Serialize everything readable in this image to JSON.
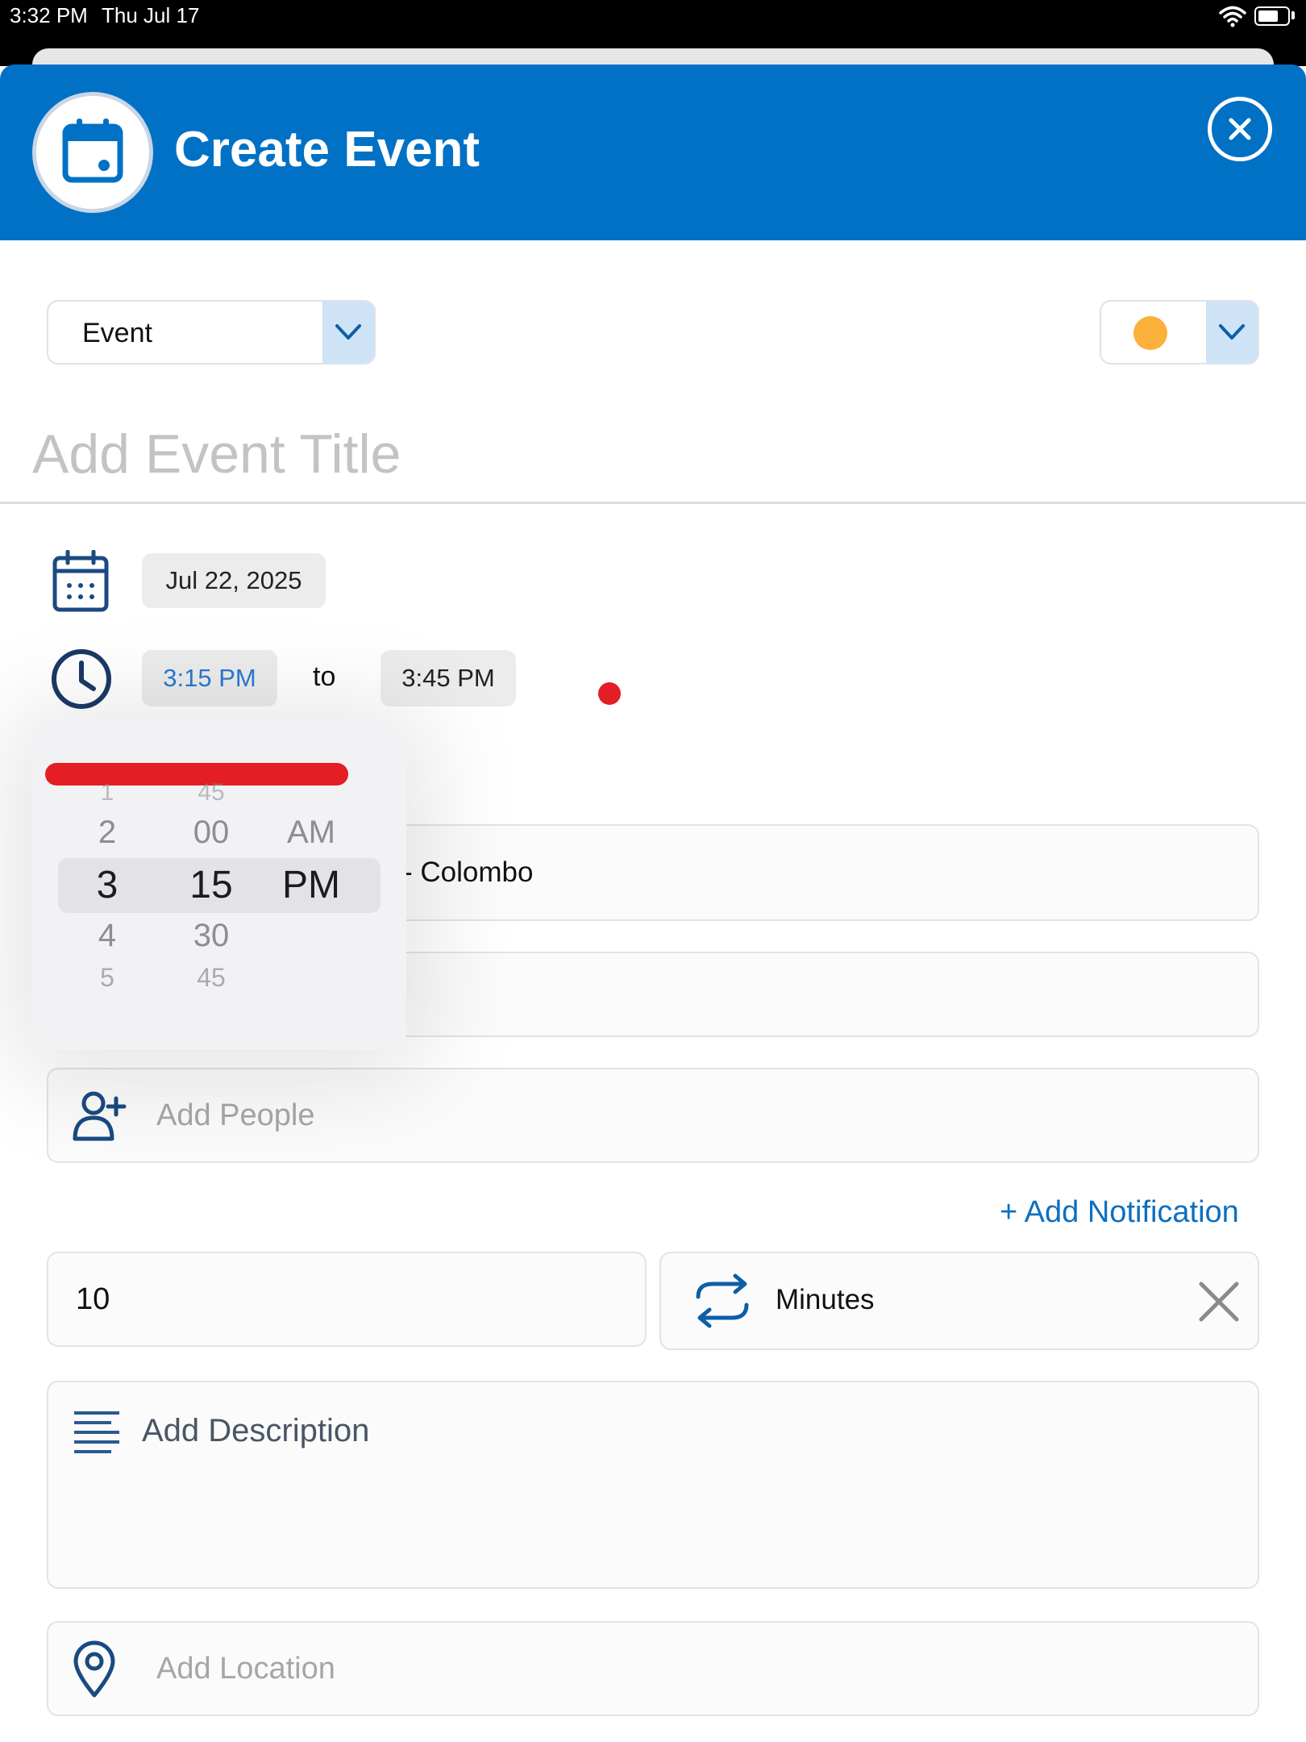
{
  "status_bar": {
    "time": "3:32 PM",
    "date": "Thu Jul 17"
  },
  "header": {
    "title": "Create Event",
    "close_icon": "close-circle-icon",
    "badge_icon": "calendar-icon"
  },
  "type_select": {
    "value": "Event",
    "icon": "chevron-down-icon"
  },
  "color_select": {
    "value": "#fbb03b",
    "icon": "chevron-down-icon"
  },
  "title_input": {
    "placeholder": "Add Event Title",
    "value": ""
  },
  "date_row": {
    "icon": "calendar-icon",
    "date": "Jul 22, 2025"
  },
  "time_row": {
    "icon": "clock-icon",
    "start": "3:15 PM",
    "separator": "to",
    "end": "3:45 PM"
  },
  "time_picker": {
    "hours": [
      "1",
      "2",
      "3",
      "4",
      "5"
    ],
    "minutes": [
      "45",
      "00",
      "15",
      "30",
      "45"
    ],
    "periods": [
      "AM",
      "PM"
    ],
    "selected": {
      "hour": "3",
      "minute": "15",
      "period": "PM"
    }
  },
  "timezone_field": {
    "visible_text": "- Colombo"
  },
  "people_field": {
    "icon": "add-person-icon",
    "placeholder": "Add People"
  },
  "notification": {
    "add_label": "+ Add Notification",
    "value": "10",
    "unit": "Minutes",
    "unit_icon": "repeat-icon",
    "remove_icon": "close-icon"
  },
  "description_field": {
    "icon": "align-left-icon",
    "placeholder": "Add Description"
  },
  "location_field": {
    "icon": "location-pin-icon",
    "placeholder": "Add Location"
  },
  "colors": {
    "brand": "#0071c5",
    "accent_red": "#e31e24",
    "event_color": "#fbb03b",
    "link": "#0d6fbf"
  }
}
